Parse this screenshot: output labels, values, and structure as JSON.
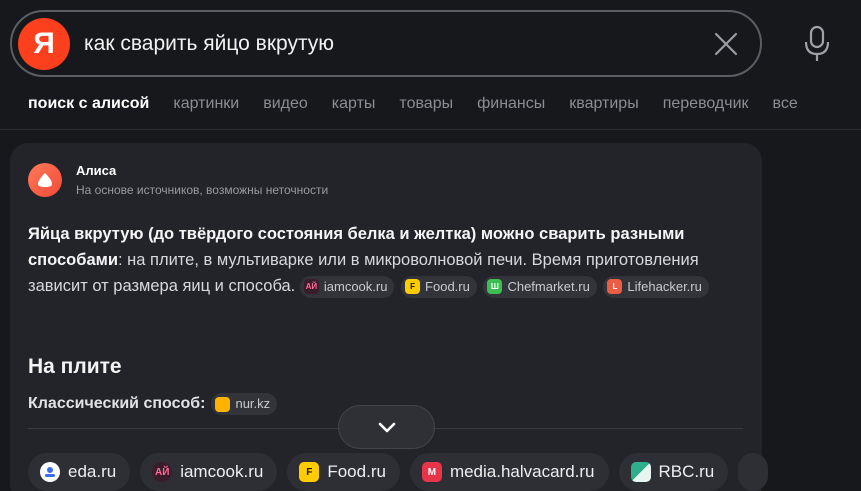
{
  "search": {
    "logo_letter": "Я",
    "query": "как сварить яйцо вкрутую"
  },
  "tabs": [
    {
      "label": "поиск с алисой",
      "active": true
    },
    {
      "label": "картинки"
    },
    {
      "label": "видео"
    },
    {
      "label": "карты"
    },
    {
      "label": "товары"
    },
    {
      "label": "финансы"
    },
    {
      "label": "квартиры"
    },
    {
      "label": "переводчик"
    },
    {
      "label": "все"
    }
  ],
  "alice": {
    "name": "Алиса",
    "subtitle": "На основе источников, возможны неточности",
    "answer_bold": "Яйца вкрутую (до твёрдого состояния белка и желтка) можно сварить разными способами",
    "answer_rest": ": на плите, в мультиварке или в микроволновой печи. Время приготовления зависит от размера яиц и способа.",
    "chips": [
      {
        "label": "iamcook.ru",
        "icon": "АЙ"
      },
      {
        "label": "Food.ru",
        "icon": "F"
      },
      {
        "label": "Chefmarket.ru",
        "icon": "Ш"
      },
      {
        "label": "Lifehacker.ru",
        "icon": "L"
      }
    ],
    "section_title": "На плите",
    "subsection_title": "Классический способ:",
    "subsection_chip": "nur.kz"
  },
  "sources": [
    {
      "label": "eda.ru",
      "icon": "eda-icon"
    },
    {
      "label": "iamcook.ru",
      "icon": "АЙ"
    },
    {
      "label": "Food.ru",
      "icon": "F"
    },
    {
      "label": "media.halvacard.ru",
      "icon": "M"
    },
    {
      "label": "RBC.ru",
      "icon": "rbc-icon"
    }
  ],
  "colors": {
    "background": "#17181c",
    "card": "#232429",
    "brand": "#fc3f1d"
  }
}
